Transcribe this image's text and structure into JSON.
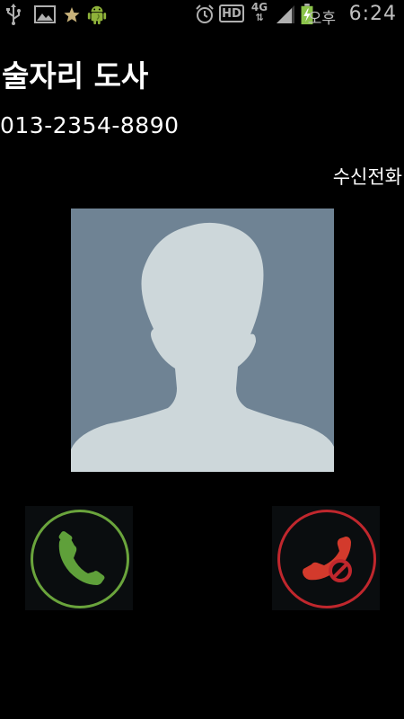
{
  "status_bar": {
    "icons": [
      "usb-icon",
      "gallery-icon",
      "star-icon",
      "android-icon",
      "alarm-icon",
      "hd-icon",
      "network-4g-icon",
      "signal-icon",
      "battery-charging-icon"
    ],
    "hd_label": "HD",
    "network_label": "4G",
    "ampm": "오후",
    "time": "6:24"
  },
  "caller": {
    "name": "술자리 도사",
    "number": "013-2354-8890",
    "status": "수신전화"
  },
  "avatar": {
    "icon": "default-contact-silhouette-icon",
    "background_color": "#6f8394",
    "silhouette_color": "#cdd7da"
  },
  "actions": {
    "accept": {
      "icon": "phone-accept-icon",
      "color": "#6aa43c"
    },
    "decline": {
      "icon": "phone-decline-icon",
      "color": "#c0272d"
    }
  }
}
